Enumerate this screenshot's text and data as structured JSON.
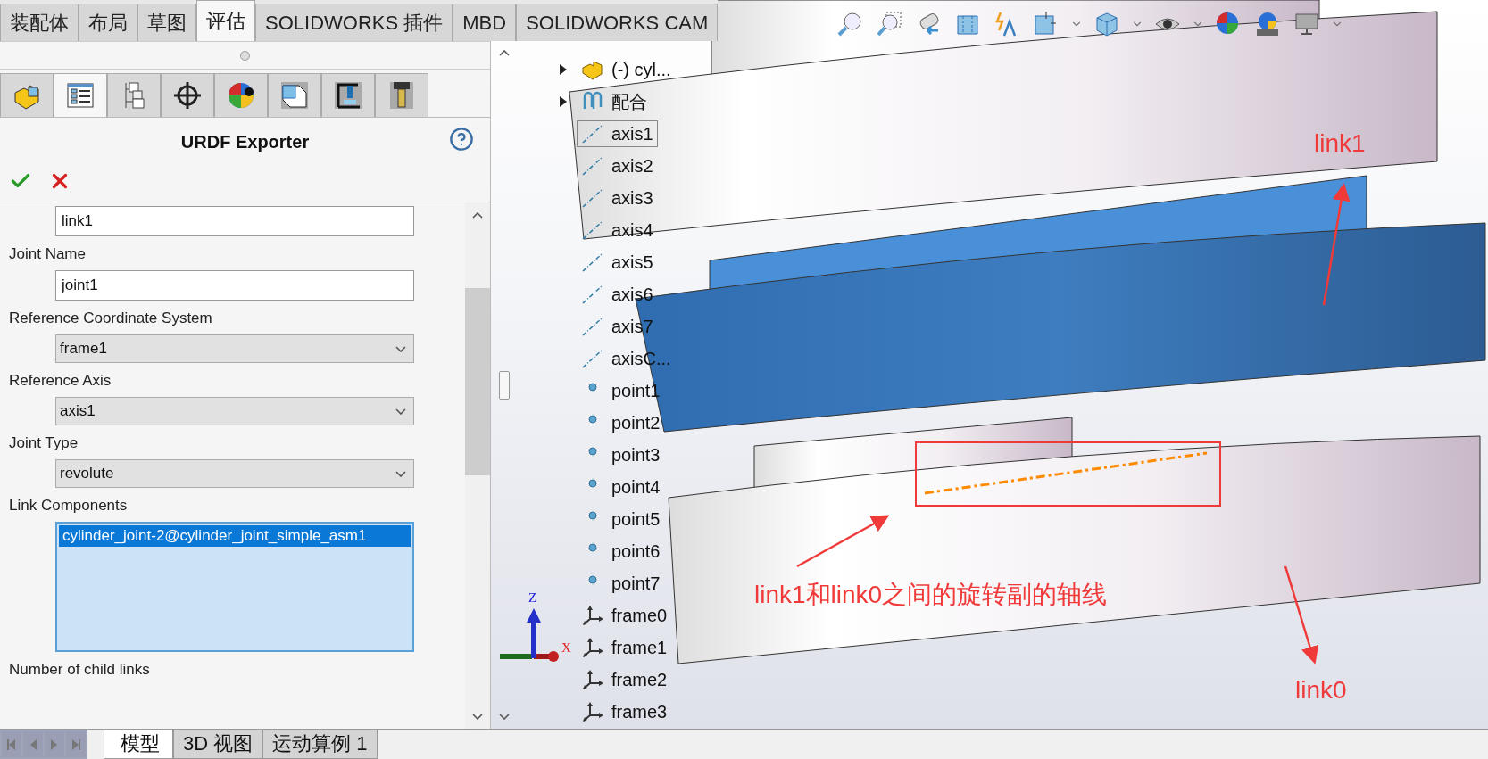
{
  "top_tabs": [
    {
      "label": "装配体",
      "selected": false
    },
    {
      "label": "布局",
      "selected": false
    },
    {
      "label": "草图",
      "selected": false
    },
    {
      "label": "评估",
      "selected": true
    },
    {
      "label": "SOLIDWORKS 插件",
      "selected": false
    },
    {
      "label": "MBD",
      "selected": false
    },
    {
      "label": "SOLIDWORKS CAM",
      "selected": false
    }
  ],
  "panel_tabs": [
    {
      "kind": "part",
      "selected": false
    },
    {
      "kind": "properties",
      "selected": true
    },
    {
      "kind": "config",
      "selected": false
    },
    {
      "kind": "crosshair",
      "selected": false
    },
    {
      "kind": "display",
      "selected": false
    },
    {
      "kind": "cube",
      "selected": false
    },
    {
      "kind": "press",
      "selected": false
    },
    {
      "kind": "drill",
      "selected": false
    }
  ],
  "property_manager": {
    "title": "URDF Exporter"
  },
  "form": [
    {
      "kind": "text",
      "value": "link1"
    },
    {
      "kind": "label",
      "text": "Joint Name"
    },
    {
      "kind": "text",
      "value": "joint1"
    },
    {
      "kind": "label",
      "text": "Reference Coordinate System"
    },
    {
      "kind": "select",
      "value": "frame1"
    },
    {
      "kind": "label",
      "text": "Reference Axis"
    },
    {
      "kind": "select",
      "value": "axis1"
    },
    {
      "kind": "label",
      "text": "Joint Type"
    },
    {
      "kind": "select",
      "value": "revolute"
    },
    {
      "kind": "label",
      "text": "Link Components"
    },
    {
      "kind": "list",
      "items": [
        {
          "label": "cylinder_joint-2@cylinder_joint_simple_asm1",
          "selected": true
        }
      ]
    },
    {
      "kind": "label",
      "text": "Number of child links"
    }
  ],
  "tree": [
    {
      "kind": "component",
      "label": "(-) cyl...",
      "expanded": false,
      "selected": false
    },
    {
      "kind": "mates",
      "label": "配合",
      "expanded": false,
      "selected": false
    },
    {
      "kind": "axis",
      "label": "axis1",
      "selected": true
    },
    {
      "kind": "axis",
      "label": "axis2",
      "selected": false
    },
    {
      "kind": "axis",
      "label": "axis3",
      "selected": false
    },
    {
      "kind": "axis",
      "label": "axis4",
      "selected": false
    },
    {
      "kind": "axis",
      "label": "axis5",
      "selected": false
    },
    {
      "kind": "axis",
      "label": "axis6",
      "selected": false
    },
    {
      "kind": "axis",
      "label": "axis7",
      "selected": false
    },
    {
      "kind": "axis",
      "label": "axisC...",
      "selected": false
    },
    {
      "kind": "point",
      "label": "point1",
      "selected": false
    },
    {
      "kind": "point",
      "label": "point2",
      "selected": false
    },
    {
      "kind": "point",
      "label": "point3",
      "selected": false
    },
    {
      "kind": "point",
      "label": "point4",
      "selected": false
    },
    {
      "kind": "point",
      "label": "point5",
      "selected": false
    },
    {
      "kind": "point",
      "label": "point6",
      "selected": false
    },
    {
      "kind": "point",
      "label": "point7",
      "selected": false
    },
    {
      "kind": "frame",
      "label": "frame0",
      "selected": false
    },
    {
      "kind": "frame",
      "label": "frame1",
      "selected": false
    },
    {
      "kind": "frame",
      "label": "frame2",
      "selected": false
    },
    {
      "kind": "frame",
      "label": "frame3",
      "selected": false
    }
  ],
  "annotations": {
    "top_label": "link1",
    "bottom_label": "link0",
    "axis_caption": "link1和link0之间的旋转副的轴线"
  },
  "triad": {
    "z": "Z",
    "x": "X"
  },
  "bottom_tabs": [
    {
      "label": "模型",
      "selected": true
    },
    {
      "label": "3D 视图",
      "selected": false
    },
    {
      "label": "运动算例 1",
      "selected": false
    }
  ]
}
